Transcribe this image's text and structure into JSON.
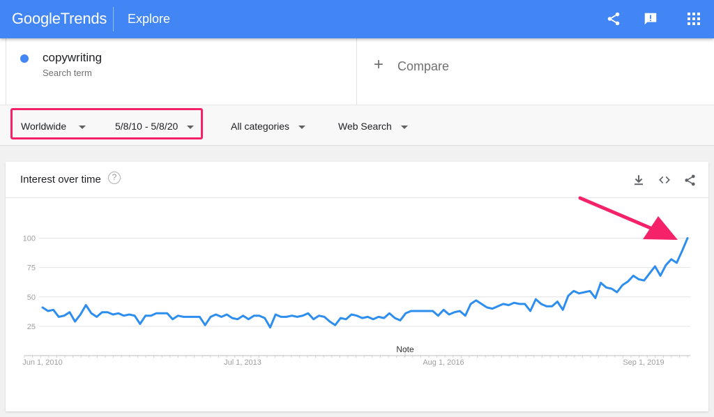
{
  "header": {
    "logo_google": "Google",
    "logo_trends": "Trends",
    "section": "Explore",
    "icons": [
      "share-icon",
      "feedback-icon",
      "apps-grid-icon"
    ]
  },
  "terms": {
    "term": "copywriting",
    "term_subtitle": "Search term",
    "term_color": "#4285f4",
    "compare_plus": "+",
    "compare_label": "Compare"
  },
  "filters": {
    "region": "Worldwide",
    "date_range": "5/8/10 - 5/8/20",
    "category": "All categories",
    "search_type": "Web Search",
    "highlight_color": "#f5226a"
  },
  "card": {
    "title": "Interest over time",
    "help_glyph": "?",
    "icons": [
      "download-icon",
      "embed-icon",
      "share-icon"
    ]
  },
  "chart_data": {
    "type": "line",
    "ylim": [
      0,
      100
    ],
    "y_ticks": [
      "100",
      "75",
      "50",
      "25"
    ],
    "x_ticks": [
      "Jun 1, 2010",
      "Jul 1, 2013",
      "Aug 1, 2016",
      "Sep 1, 2019"
    ],
    "note_label": "Note",
    "line_color": "#2d8ef0",
    "arrow_color": "#f5226a",
    "series": [
      {
        "values": [
          41,
          38,
          39,
          33,
          34,
          37,
          29,
          35,
          43,
          36,
          33,
          37,
          37,
          35,
          36,
          34,
          35,
          34,
          27,
          34,
          34,
          36,
          36,
          36,
          31,
          34,
          33,
          33,
          33,
          33,
          26,
          33,
          35,
          33,
          35,
          32,
          31,
          34,
          31,
          34,
          34,
          32,
          24,
          35,
          33,
          33,
          34,
          33,
          34,
          36,
          31,
          34,
          33,
          29,
          26,
          32,
          31,
          35,
          34,
          32,
          33,
          31,
          33,
          32,
          36,
          32,
          30,
          36,
          38,
          38,
          38,
          38,
          38,
          34,
          39,
          35,
          37,
          38,
          34,
          44,
          47,
          44,
          41,
          40,
          42,
          44,
          43,
          45,
          44,
          44,
          38,
          48,
          44,
          42,
          42,
          46,
          39,
          51,
          55,
          53,
          54,
          55,
          49,
          62,
          58,
          57,
          54,
          60,
          63,
          68,
          65,
          64,
          70,
          76,
          68,
          77,
          82,
          79,
          89,
          100
        ]
      }
    ]
  }
}
